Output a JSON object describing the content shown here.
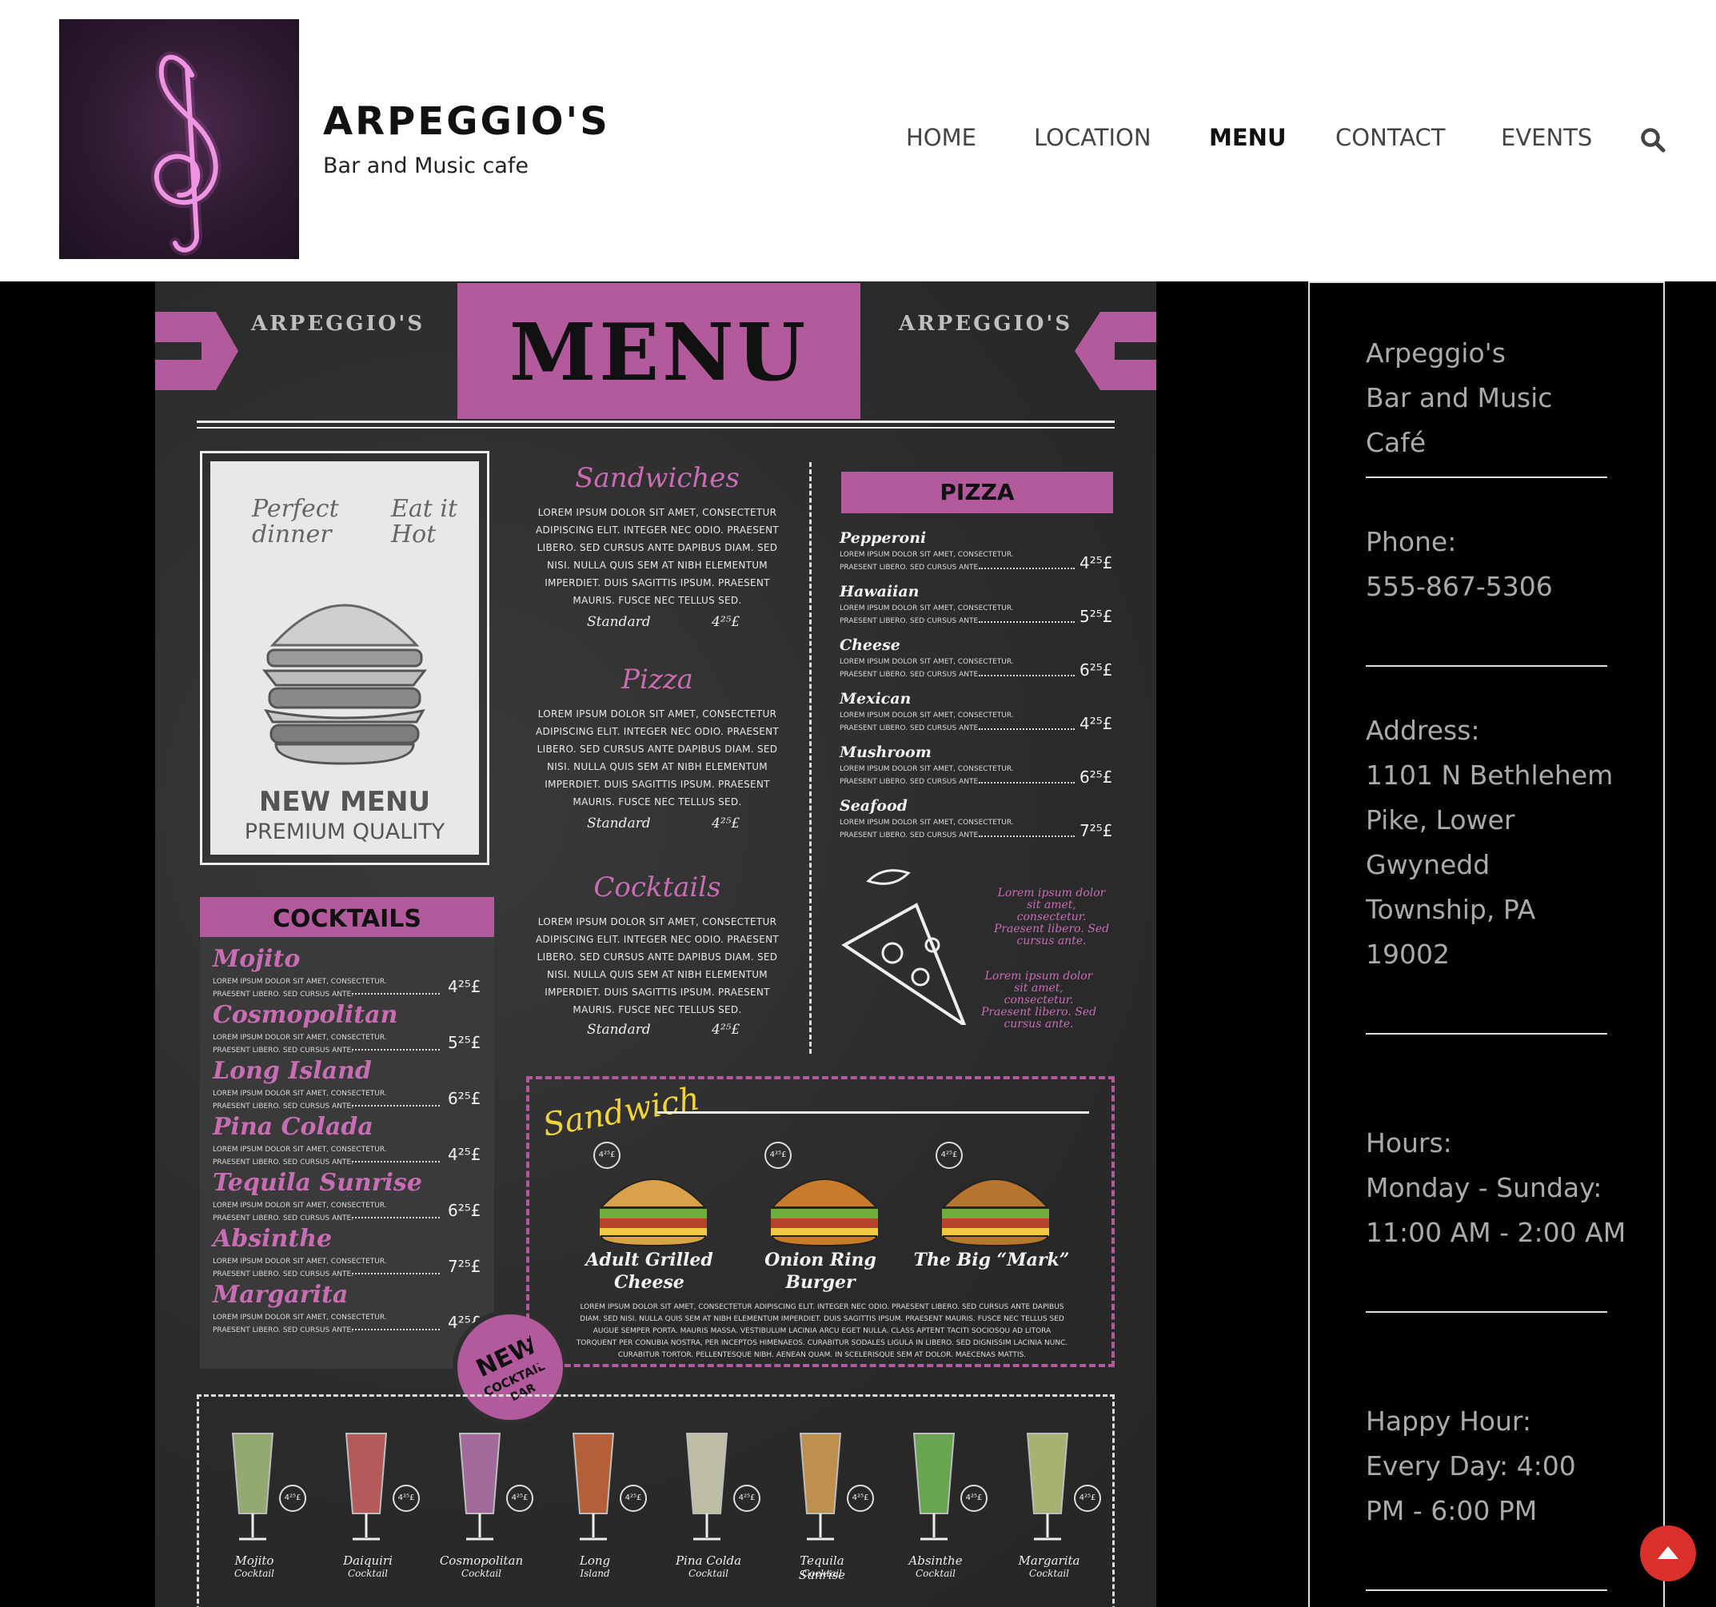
{
  "site": {
    "title": "ARPEGGIO'S",
    "tagline": "Bar and Music cafe"
  },
  "nav": {
    "items": [
      {
        "label": "HOME",
        "active": false
      },
      {
        "label": "LOCATION",
        "active": false
      },
      {
        "label": "MENU",
        "active": true
      },
      {
        "label": "CONTACT",
        "active": false
      },
      {
        "label": "EVENTS",
        "active": false
      }
    ]
  },
  "menu_image": {
    "brand_left": "ARPEGGIO'S",
    "brand_right": "ARPEGGIO'S",
    "title": "MENU",
    "burger_card": {
      "note_left": "Perfect dinner",
      "note_right": "Eat it Hot",
      "headline": "NEW MENU",
      "subline": "PREMIUM QUALITY"
    },
    "sections": [
      {
        "title": "Sandwiches",
        "text": "Lorem ipsum dolor sit amet, consectetur adipiscing elit. Integer nec odio. Praesent libero. Sed cursus ante dapibus diam. Sed nisi. Nulla quis sem at nibh elementum imperdiet. Duis sagittis ipsum. Praesent mauris. Fusce nec tellus sed.",
        "std_label": "Standard",
        "std_price": "4²⁵£"
      },
      {
        "title": "Pizza",
        "text": "Lorem ipsum dolor sit amet, consectetur adipiscing elit. Integer nec odio. Praesent libero. Sed cursus ante dapibus diam. Sed nisi. Nulla quis sem at nibh elementum imperdiet. Duis sagittis ipsum. Praesent mauris. Fusce nec tellus sed.",
        "std_label": "Standard",
        "std_price": "4²⁵£"
      },
      {
        "title": "Cocktails",
        "text": "Lorem ipsum dolor sit amet, consectetur adipiscing elit. Integer nec odio. Praesent libero. Sed cursus ante dapibus diam. Sed nisi. Nulla quis sem at nibh elementum imperdiet. Duis sagittis ipsum. Praesent mauris. Fusce nec tellus sed.",
        "std_label": "Standard",
        "std_price": "4²⁵£"
      }
    ],
    "pizza": {
      "heading": "PIZZA",
      "desc": "Lorem ipsum dolor sit amet, consectetur. Praesent libero. Sed cursus ante.",
      "items": [
        {
          "name": "Pepperoni",
          "price": "4²⁵£"
        },
        {
          "name": "Hawaiian",
          "price": "5²⁵£"
        },
        {
          "name": "Cheese",
          "price": "6²⁵£"
        },
        {
          "name": "Mexican",
          "price": "4²⁵£"
        },
        {
          "name": "Mushroom",
          "price": "6²⁵£"
        },
        {
          "name": "Seafood",
          "price": "7²⁵£"
        }
      ],
      "note_1": "Lorem ipsum dolor sit amet, consectetur. Praesent libero. Sed cursus ante.",
      "note_2": "Lorem ipsum dolor sit amet, consectetur. Praesent libero. Sed cursus ante."
    },
    "cocktails": {
      "heading": "COCKTAILS",
      "desc": "Lorem ipsum dolor sit amet, consectetur. Praesent libero. Sed cursus ante.",
      "items": [
        {
          "name": "Mojito",
          "price": "4²⁵£"
        },
        {
          "name": "Cosmopolitan",
          "price": "5²⁵£"
        },
        {
          "name": "Long Island",
          "price": "6²⁵£"
        },
        {
          "name": "Pina Colada",
          "price": "4²⁵£"
        },
        {
          "name": "Tequila Sunrise",
          "price": "6²⁵£"
        },
        {
          "name": "Absinthe",
          "price": "7²⁵£"
        },
        {
          "name": "Margarita",
          "price": "4²⁵£"
        }
      ]
    },
    "badge": {
      "line1": "NEW",
      "line2": "COCKTAIL",
      "line3": "BAR"
    },
    "sandwich_box": {
      "heading": "Sandwich",
      "items": [
        {
          "name": "Adult Grilled Cheese",
          "price": "4²⁵£"
        },
        {
          "name": "Onion Ring Burger",
          "price": "4²⁵£"
        },
        {
          "name": "The Big “Mark”",
          "price": "4²⁵£"
        }
      ],
      "text": "Lorem ipsum dolor sit amet, consectetur adipiscing elit. Integer nec odio. Praesent libero. Sed cursus ante dapibus diam. Sed nisi. Nulla quis sem at nibh elementum imperdiet. Duis sagittis ipsum. Praesent mauris. Fusce nec tellus sed augue semper porta. Mauris massa. Vestibulum lacinia arcu eget nulla. Class aptent taciti sociosqu ad litora torquent per conubia nostra, per inceptos himenaeos. Curabitur sodales ligula in libero. Sed dignissim lacinia nunc. Curabitur tortor. Pellentesque nibh. Aenean quam. In scelerisque sem at dolor. Maecenas mattis."
    },
    "drinks": [
      {
        "name": "Mojito",
        "sub": "Cocktail",
        "price": "4²⁵£"
      },
      {
        "name": "Daiquiri",
        "sub": "Cocktail",
        "price": "4²⁵£"
      },
      {
        "name": "Cosmopolitan",
        "sub": "Cocktail",
        "price": "4²⁵£"
      },
      {
        "name": "Long",
        "sub": "Island",
        "price": "4²⁵£"
      },
      {
        "name": "Pina Colda",
        "sub": "Cocktail",
        "price": "4²⁵£"
      },
      {
        "name": "Tequila Sunrise",
        "sub": "Cocktail",
        "price": "4²⁵£"
      },
      {
        "name": "Absinthe",
        "sub": "Cocktail",
        "price": "4²⁵£"
      },
      {
        "name": "Margarita",
        "sub": "Cocktail",
        "price": "4²⁵£"
      }
    ]
  },
  "sidebar": {
    "name_lines": [
      "Arpeggio's",
      "Bar and Music",
      "Café"
    ],
    "phone_label": "Phone:",
    "phone": "555-867-5306",
    "address_label": "Address:",
    "address_lines": [
      "1101 N Bethlehem",
      "Pike, Lower",
      "Gwynedd",
      "Township, PA",
      "19002"
    ],
    "hours_label": "Hours:",
    "hours_lines": [
      "Monday - Sunday:",
      "11:00 AM - 2:00 AM"
    ],
    "happy_label": "Happy Hour:",
    "happy_lines": [
      "Every Day: 4:00",
      "PM - 6:00 PM"
    ]
  },
  "colors": {
    "accent_pink": "#b25a9c",
    "scroll_button": "#d9302c"
  },
  "icons": {
    "logo": "treble-clef-icon",
    "search": "search-icon",
    "scroll_top": "chevron-up-icon"
  }
}
